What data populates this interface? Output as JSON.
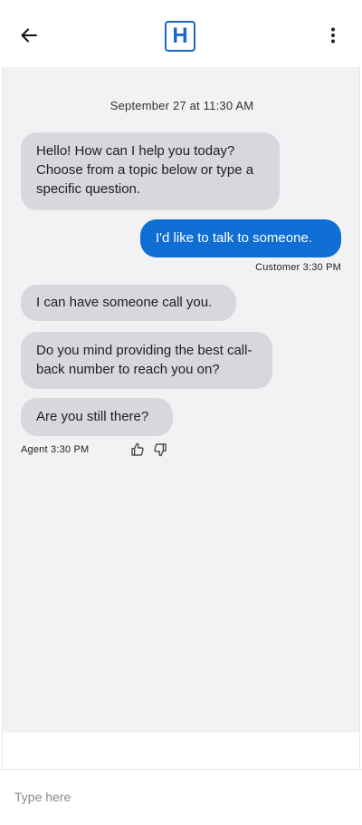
{
  "header": {
    "logo_letter": "H",
    "back_icon": "arrow-left-icon",
    "more_icon": "vertical-dots-icon",
    "brand_color": "#1a68c7"
  },
  "chat": {
    "timestamp": "September 27 at 11:30 AM",
    "messages": [
      {
        "sender": "agent",
        "text": "Hello! How can I help you today? Choose from a topic below or type a specific question."
      },
      {
        "sender": "customer",
        "text": "I'd like to talk to someone.",
        "meta": "Customer 3:30 PM"
      },
      {
        "sender": "agent",
        "text": "I can have someone call you."
      },
      {
        "sender": "agent",
        "text": "Do you mind providing the best call-back number to reach you on?"
      },
      {
        "sender": "agent",
        "text": "Are you still there?",
        "meta": "Agent 3:30 PM"
      }
    ],
    "agent_bubble_color": "#d7d7dc",
    "customer_bubble_color": "#0f6ed4",
    "background_color": "#f2f2f5"
  },
  "feedback": {
    "thumbs_up_icon": "thumbs-up-icon",
    "thumbs_down_icon": "thumbs-down-icon"
  },
  "composer": {
    "placeholder": "Type here",
    "value": ""
  }
}
